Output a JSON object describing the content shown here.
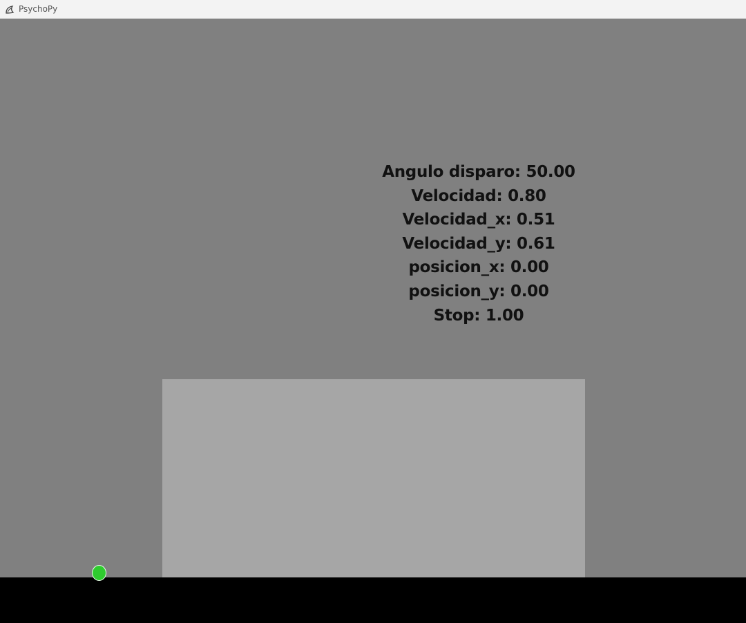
{
  "window": {
    "title": "PsychoPy",
    "icon": "psychopy-logo-icon"
  },
  "hud": {
    "lines": [
      "Angulo disparo: 50.00",
      "Velocidad: 0.80",
      "Velocidad_x: 0.51",
      "Velocidad_y: 0.61",
      "posicion_x: 0.00",
      "posicion_y: 0.00",
      "Stop: 1.00"
    ]
  },
  "colors": {
    "background": "#808080",
    "panel": "#a6a6a6",
    "ground": "#000000",
    "ball": "#2ecc2e",
    "text": "#111111"
  }
}
